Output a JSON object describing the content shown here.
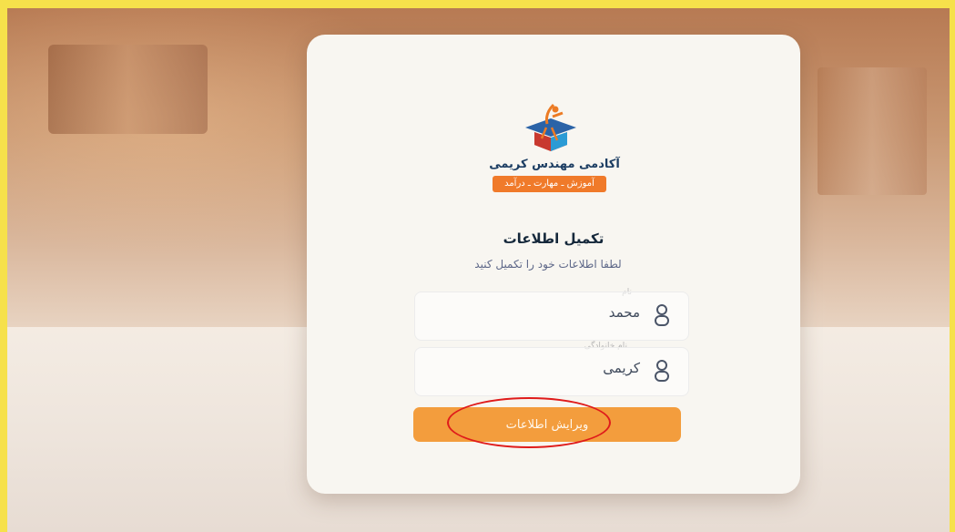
{
  "brand": {
    "name": "آکادمی مهندس کریمی",
    "tagline": "آموزش ـ مهارت ـ درآمد",
    "colors": {
      "accent": "#f39d3d",
      "tagline_bg": "#f07a2a",
      "primary_dark": "#1d3e63",
      "annotation": "#df1b1b"
    }
  },
  "form": {
    "heading": "تکمیل اطلاعات",
    "subheading": "لطفا اطلاعات خود را تکمیل کنید",
    "fields": [
      {
        "label": "نام",
        "value": "محمد",
        "icon": "user-icon"
      },
      {
        "label": "نام خانوادگی",
        "value": "کریمی",
        "icon": "user-icon"
      }
    ],
    "submit_label": "ویرایش اطلاعات"
  }
}
